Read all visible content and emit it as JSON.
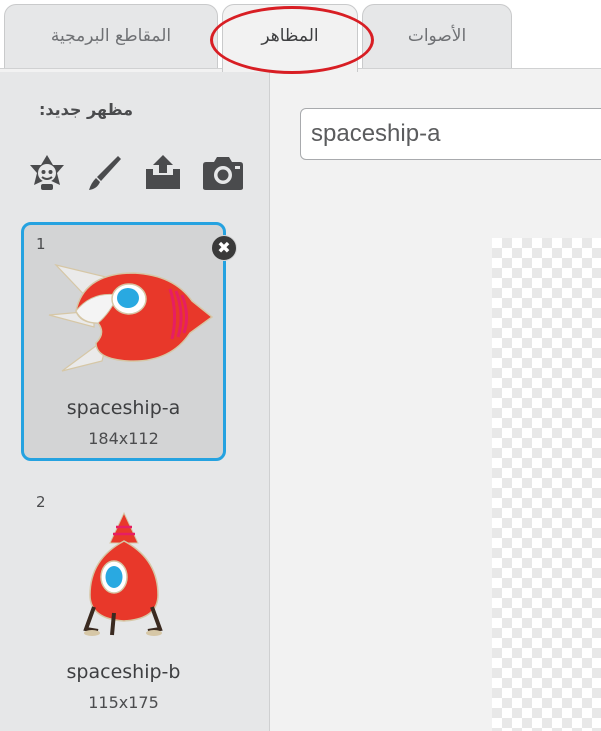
{
  "tabs": [
    {
      "label": "المقاطع البرمجية",
      "icon": "",
      "selected": false
    },
    {
      "label": "المظاهر",
      "icon": "",
      "selected": true
    },
    {
      "label": "الأصوات",
      "icon": "",
      "selected": false
    }
  ],
  "left_panel": {
    "new_costume_label": "مظهر جديد:",
    "tools": [
      {
        "name": "choose-from-library",
        "icon": "sprite-library-icon"
      },
      {
        "name": "paint-new",
        "icon": "paintbrush-icon"
      },
      {
        "name": "upload-from-file",
        "icon": "upload-icon"
      },
      {
        "name": "new-from-camera",
        "icon": "camera-icon"
      }
    ],
    "costumes": [
      {
        "number": "1",
        "name": "spaceship-a",
        "size": "184x112",
        "selected": true
      },
      {
        "number": "2",
        "name": "spaceship-b",
        "size": "115x175",
        "selected": false
      }
    ],
    "delete_symbol": "✖"
  },
  "editor": {
    "costume_name_value": "spaceship-a"
  },
  "colors": {
    "selection_border": "#25a2e0",
    "highlight_ring": "#d81e24",
    "panel_bg": "#e6e7e8",
    "ship_red": "#e8382a",
    "ship_blue": "#29a9e1"
  }
}
